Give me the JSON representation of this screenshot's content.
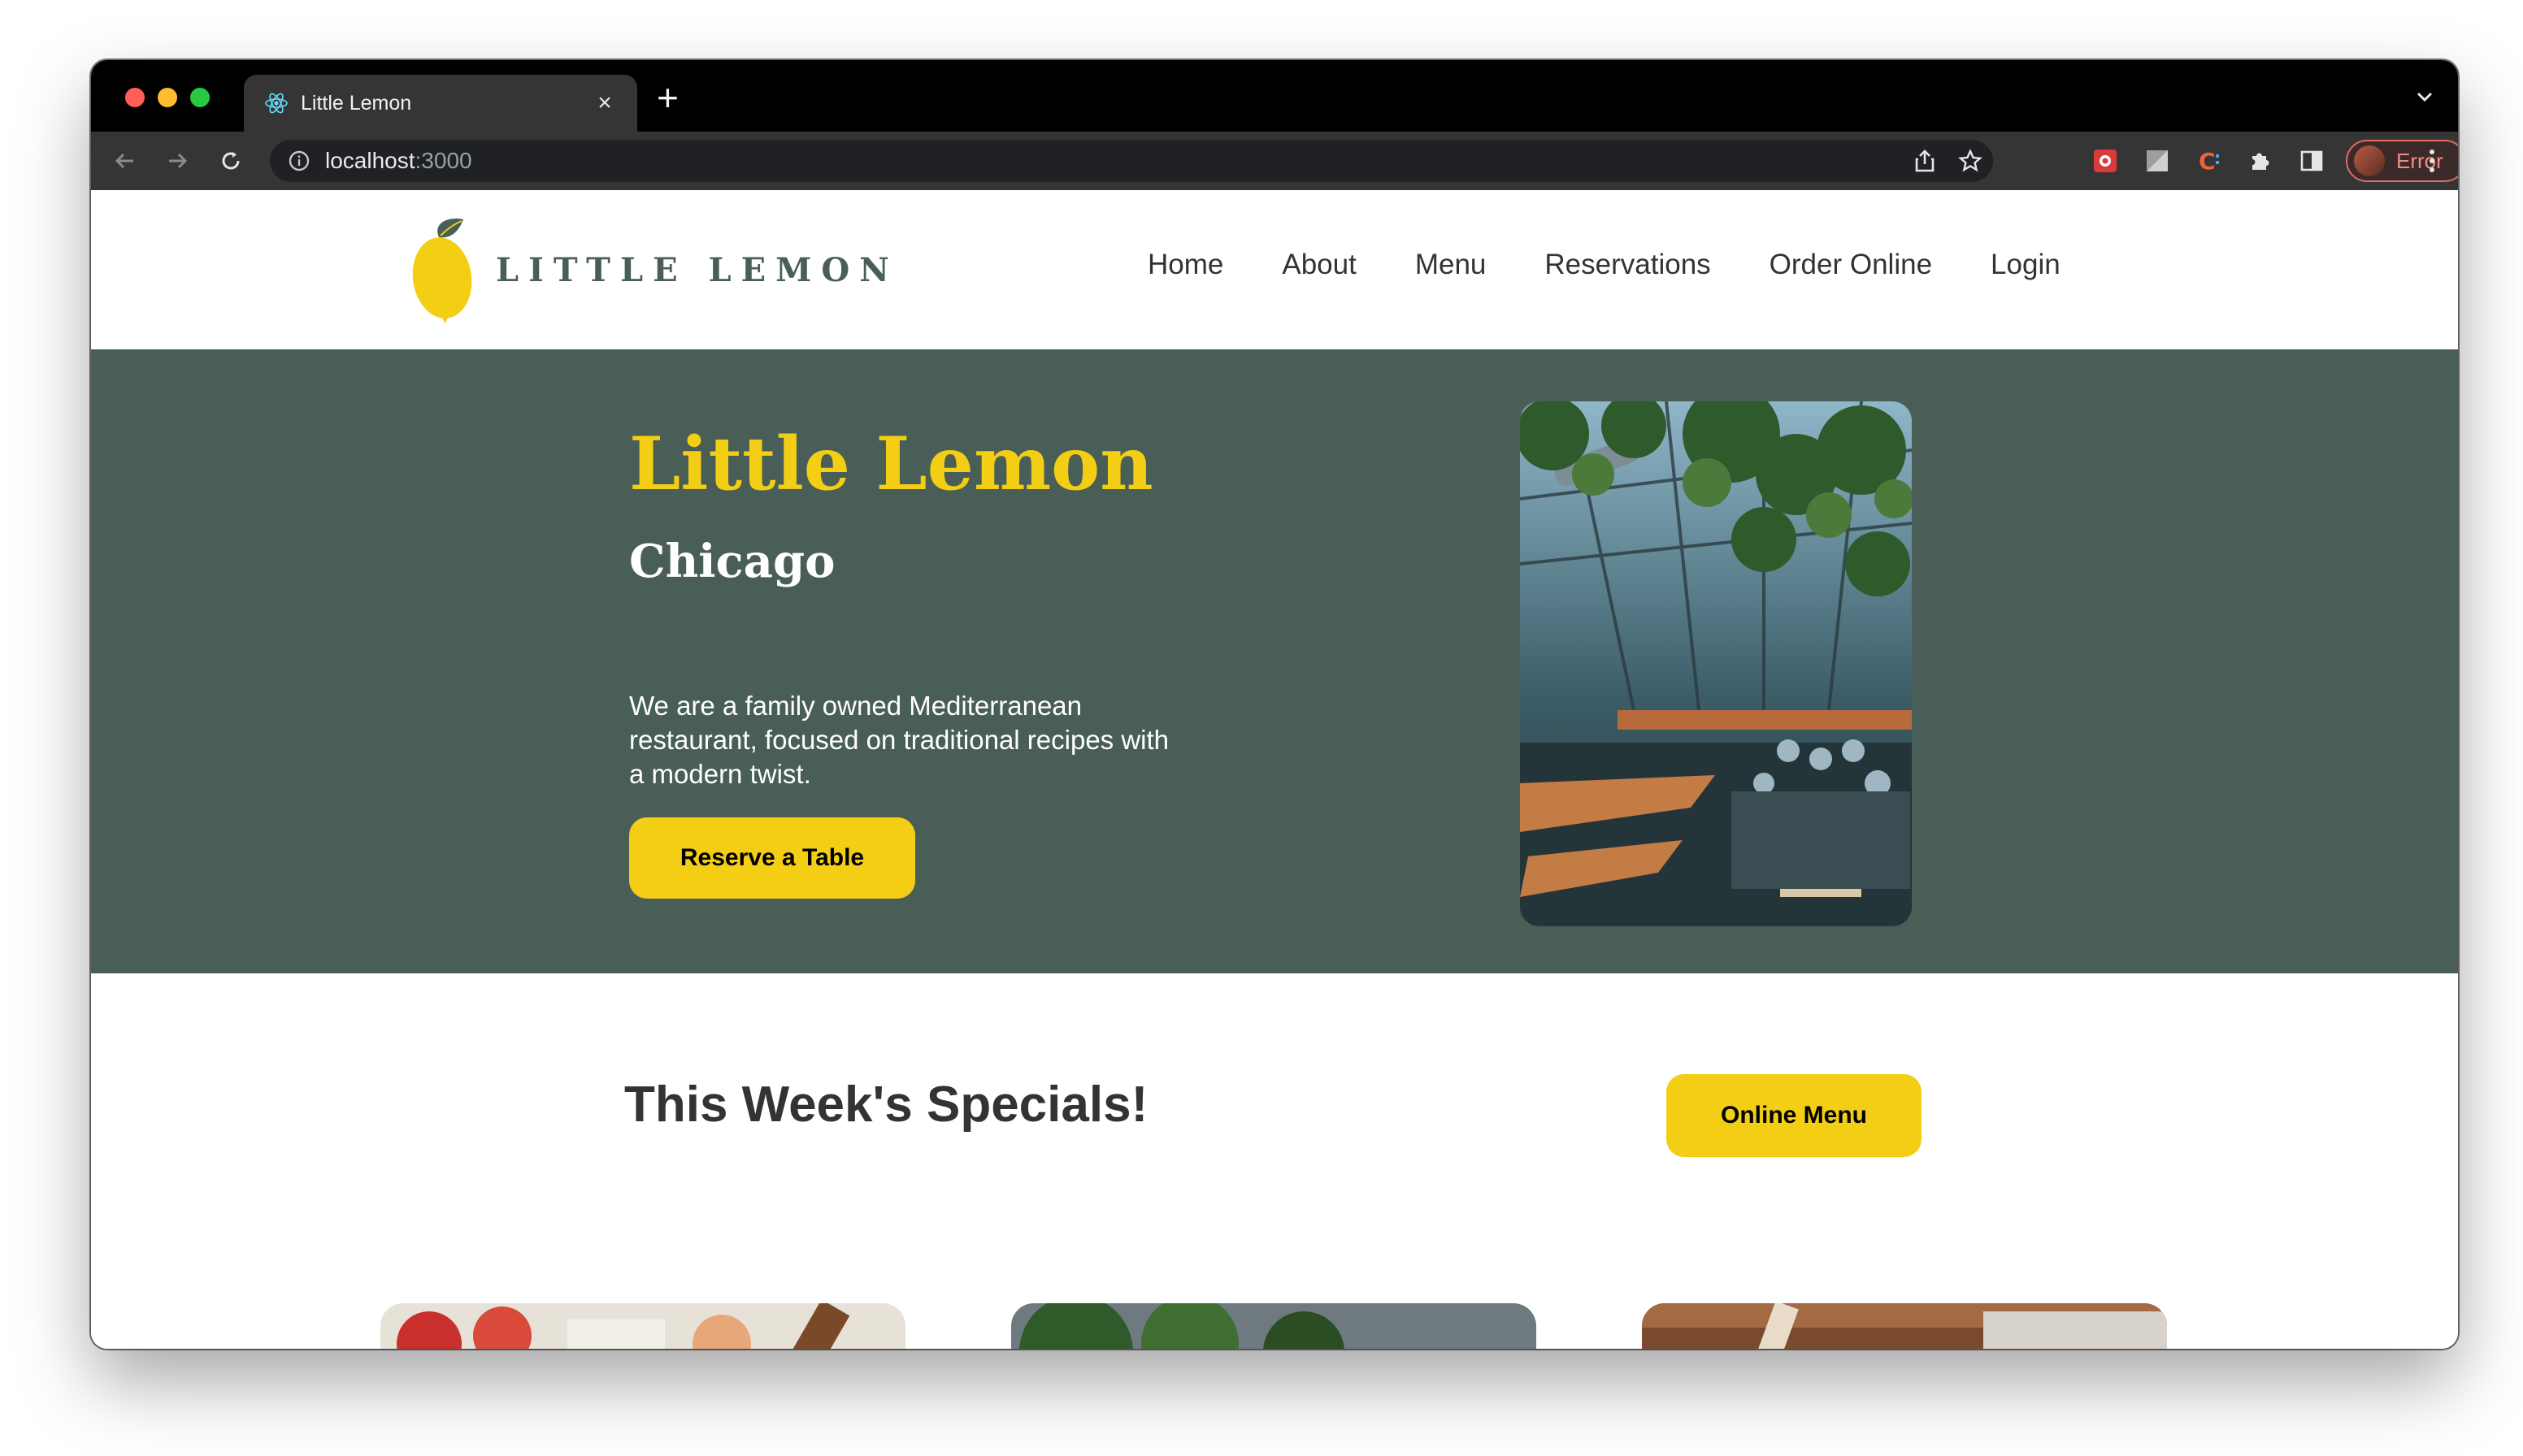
{
  "browser": {
    "tab": {
      "title": "Little Lemon",
      "icon": "react-atom-icon"
    },
    "url": {
      "host": "localhost",
      "port": ":3000"
    },
    "profile_label": "Error",
    "new_tab_symbol": "+",
    "close_symbol": "×"
  },
  "site": {
    "logo_text": "LITTLE LEMON",
    "nav": [
      "Home",
      "About",
      "Menu",
      "Reservations",
      "Order Online",
      "Login"
    ],
    "hero": {
      "title": "Little Lemon",
      "subtitle": "Chicago",
      "description": "We are a family owned Mediterranean restaurant, focused on traditional recipes with a modern twist.",
      "cta_label": "Reserve a Table"
    },
    "specials": {
      "title": "This Week's Specials!",
      "button_label": "Online Menu"
    }
  },
  "colors": {
    "brand_green": "#495e57",
    "brand_yellow": "#f4ce14",
    "chrome_dark": "#353535",
    "profile_error": "#f28b82"
  }
}
